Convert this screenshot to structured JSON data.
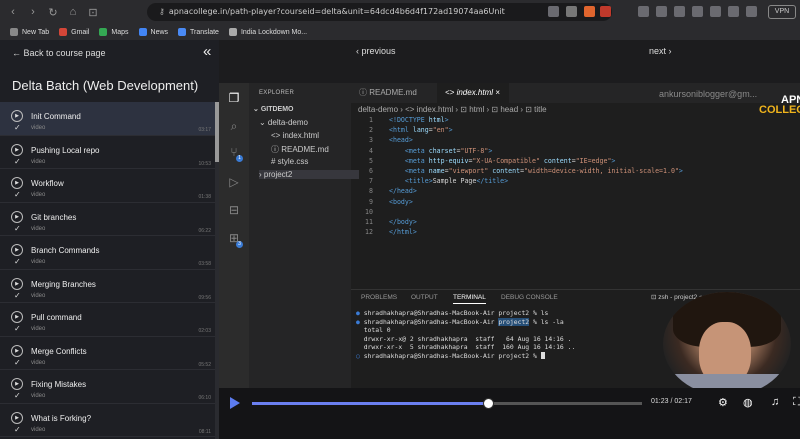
{
  "browser": {
    "url": "apnacollege.in/path-player?courseid=delta&unit=64dcd4b6d4f172ad19074aa6Unit",
    "vpn_label": "VPN",
    "bookmarks": [
      "New Tab",
      "Gmail",
      "Maps",
      "News",
      "Translate",
      "India Lockdown Mo..."
    ]
  },
  "sidebar": {
    "back_label": "Back to course page",
    "course_title": "Delta Batch (Web Development)",
    "lessons": [
      {
        "title": "Init Command",
        "sub": "video",
        "time": "03:17",
        "active": true
      },
      {
        "title": "Pushing Local repo",
        "sub": "video",
        "time": "10:53"
      },
      {
        "title": "Workflow",
        "sub": "video",
        "time": "01:38"
      },
      {
        "title": "Git branches",
        "sub": "video",
        "time": "06:22"
      },
      {
        "title": "Branch Commands",
        "sub": "video",
        "time": "03:58"
      },
      {
        "title": "Merging Branches",
        "sub": "video",
        "time": "09:56"
      },
      {
        "title": "Pull command",
        "sub": "video",
        "time": "02:03"
      },
      {
        "title": "Merge Conflicts",
        "sub": "video",
        "time": "05:52"
      },
      {
        "title": "Fixing Mistakes",
        "sub": "video",
        "time": "06:10"
      },
      {
        "title": "What is Forking?",
        "sub": "video",
        "time": "08:11"
      }
    ]
  },
  "player": {
    "prev_label": "‹ previous",
    "next_label": "next ›",
    "time": "01:23 / 02:17",
    "progress": 0.605
  },
  "vscode": {
    "explorer_title": "EXPLORER",
    "root": "GITDEMO",
    "tree": [
      {
        "label": "⌄ delta-demo",
        "depth": 1
      },
      {
        "label": "<> index.html",
        "depth": 2
      },
      {
        "label": "ⓘ README.md",
        "depth": 2
      },
      {
        "label": "# style.css",
        "depth": 2
      },
      {
        "label": "› project2",
        "depth": 1
      }
    ],
    "tabs": [
      "ⓘ README.md",
      "<> index.html  ×"
    ],
    "breadcrumb": "delta-demo  ›  <> index.html  ›  ⊡ html  ›  ⊡ head  ›  ⊡ title",
    "watermark": "ankursoniblogger@gm...",
    "logo_line1": "APNA",
    "logo_line2": "COLLEGE",
    "code_lines": [
      {
        "n": "1",
        "html": "<span class='tg'>&lt;!DOCTYPE</span> <span class='at'>html</span><span class='tg'>&gt;</span>"
      },
      {
        "n": "2",
        "html": "<span class='tg'>&lt;html</span> <span class='at'>lang</span>=<span class='st'>\"en\"</span><span class='tg'>&gt;</span>"
      },
      {
        "n": "3",
        "html": "<span class='tg'>&lt;head&gt;</span>"
      },
      {
        "n": "4",
        "html": "    <span class='tg'>&lt;meta</span> <span class='at'>charset</span>=<span class='st'>\"UTF-8\"</span><span class='tg'>&gt;</span>"
      },
      {
        "n": "5",
        "html": "    <span class='tg'>&lt;meta</span> <span class='at'>http-equiv</span>=<span class='st'>\"X-UA-Compatible\"</span> <span class='at'>content</span>=<span class='st'>\"IE=edge\"</span><span class='tg'>&gt;</span>"
      },
      {
        "n": "6",
        "html": "    <span class='tg'>&lt;meta</span> <span class='at'>name</span>=<span class='st'>\"viewport\"</span> <span class='at'>content</span>=<span class='st'>\"width=device-width, initial-scale=1.0\"</span><span class='tg'>&gt;</span>"
      },
      {
        "n": "7",
        "html": "    <span class='tg'>&lt;title&gt;</span>Sample Page<span class='tg'>&lt;/title&gt;</span>"
      },
      {
        "n": "8",
        "html": "<span class='tg'>&lt;/head&gt;</span>"
      },
      {
        "n": "9",
        "html": "<span class='tg'>&lt;body&gt;</span>"
      },
      {
        "n": "10",
        "html": ""
      },
      {
        "n": "11",
        "html": "<span class='tg'>&lt;/body&gt;</span>"
      },
      {
        "n": "12",
        "html": "<span class='tg'>&lt;/html&gt;</span>"
      }
    ],
    "terminal_tabs": [
      "PROBLEMS",
      "OUTPUT",
      "TERMINAL",
      "DEBUG CONSOLE"
    ],
    "terminal_shell": "⊡ zsh - project2  +",
    "terminal_lines": [
      "<span class='dot'>●</span> shradhakhapra@Shradhas-MacBook-Air project2 % ls",
      "<span class='dot'>●</span> shradhakhapra@Shradhas-MacBook-Air <span class='hl'>project2</span> % ls -la",
      "  total 0",
      "  drwxr-xr-x@ 2 shradhakhapra  staff   64 Aug 16 14:16 .",
      "  drwxr-xr-x  5 shradhakhapra  staff  160 Aug 16 14:16 ..",
      "<span class='dot'>○</span> shradhakhapra@Shradhas-MacBook-Air project2 % "
    ]
  }
}
